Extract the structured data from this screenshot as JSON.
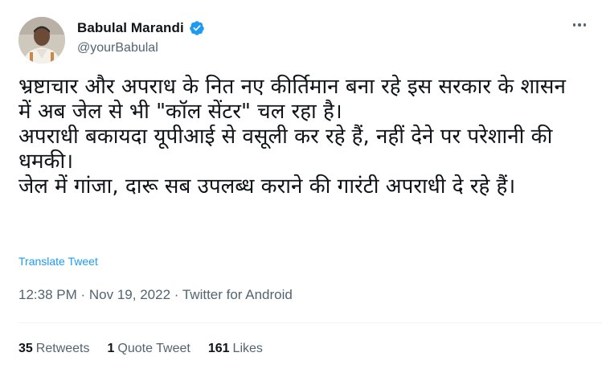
{
  "author": {
    "name": "Babulal Marandi",
    "handle": "@yourBabulal",
    "verified": true
  },
  "tweet": {
    "text": "भ्रष्टाचार और अपराध के नित नए कीर्तिमान बना रहे इस सरकार के शासन में अब जेल से भी \"कॉल सेंटर\" चल रहा है।\nअपराधी बकायदा यूपीआई से वसूली कर रहे हैं, नहीं देने पर परेशानी की धमकी।\nजेल में गांजा, दारू सब उपलब्ध कराने की गारंटी अपराधी दे रहे हैं।",
    "translate_label": "Translate Tweet",
    "time": "12:38 PM",
    "date": "Nov 19, 2022",
    "source": "Twitter for Android",
    "separator": "·"
  },
  "stats": {
    "retweets": {
      "count": "35",
      "label": "Retweets"
    },
    "quotes": {
      "count": "1",
      "label": "Quote Tweet"
    },
    "likes": {
      "count": "161",
      "label": "Likes"
    }
  },
  "colors": {
    "accent": "#1d9bf0",
    "text": "#0f1419",
    "secondary": "#536471",
    "divider": "#eff3f4"
  },
  "icons": {
    "verified": "verified-badge-icon",
    "more": "more-options-icon"
  }
}
